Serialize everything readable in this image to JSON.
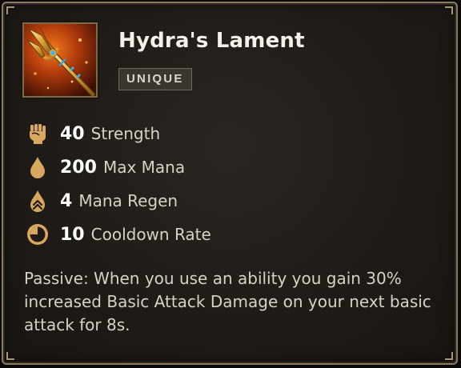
{
  "item": {
    "name": "Hydra's Lament",
    "rarity": "UNIQUE",
    "icon": "trident-icon"
  },
  "stats": [
    {
      "value": "40",
      "label": "Strength",
      "icon": "strength-fist-icon"
    },
    {
      "value": "200",
      "label": "Max Mana",
      "icon": "mana-drop-icon"
    },
    {
      "value": "4",
      "label": "Mana Regen",
      "icon": "mana-regen-icon"
    },
    {
      "value": "10",
      "label": "Cooldown Rate",
      "icon": "cooldown-clock-icon"
    }
  ],
  "passive": "Passive: When you use an ability you gain 30% increased Basic Attack Damage on your next basic attack for 8s.",
  "colors": {
    "accent_gold": "#d9a85f",
    "frame_border": "#8a7a5e",
    "badge_bg": "#3b3730",
    "text_primary": "#ffffff",
    "text_secondary": "#d8d2c6"
  }
}
